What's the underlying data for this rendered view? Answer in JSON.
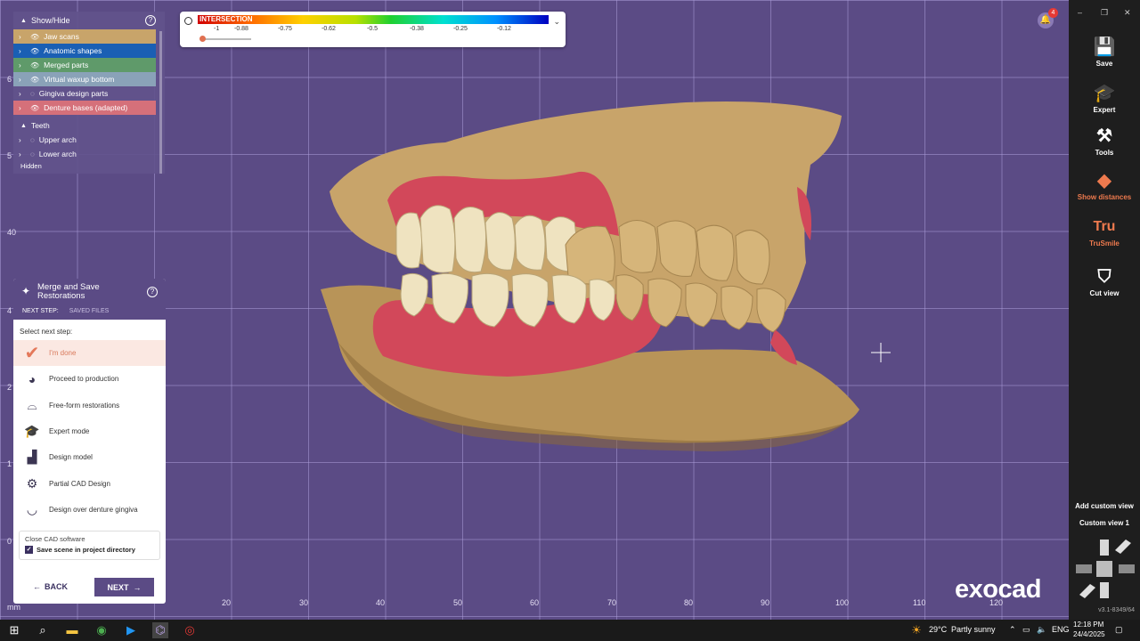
{
  "window_controls": {
    "minimize": "–",
    "restore": "❐",
    "close": "✕"
  },
  "scale": {
    "title": "INTERSECTION",
    "ticks": [
      "-1",
      "-0.88",
      "-0.75",
      "-0.62",
      "-0.5",
      "-0.38",
      "-0.25",
      "-0.12"
    ],
    "slider_fraction": 0.05,
    "icon": "gauge-icon",
    "expand_icon": "chevron-down-icon"
  },
  "showhide": {
    "title": "Show/Hide",
    "items": [
      {
        "label": "Jaw scans",
        "color": "#c8a46a"
      },
      {
        "label": "Anatomic shapes",
        "color": "#1a5fb4"
      },
      {
        "label": "Merged parts",
        "color": "#5f9a6a"
      },
      {
        "label": "Virtual waxup bottom",
        "color": "#8aa2b8"
      },
      {
        "label": "Gingiva design parts",
        "color": ""
      },
      {
        "label": "Denture bases (adapted)",
        "color": "#d5707a"
      }
    ],
    "teeth_label": "Teeth",
    "teeth_items": [
      "Upper arch",
      "Lower arch"
    ],
    "hidden_label": "Hidden"
  },
  "merge": {
    "title": "Merge and Save Restorations",
    "tab_next": "NEXT STEP:",
    "tab_saved": "SAVED FILES",
    "select_label": "Select next step:",
    "options": [
      {
        "label": "I'm done",
        "icon": "checkmark-icon",
        "active": true
      },
      {
        "label": "Proceed to production",
        "icon": "production-icon"
      },
      {
        "label": "Free-form restorations",
        "icon": "freeform-icon"
      },
      {
        "label": "Expert mode",
        "icon": "expert-cap-icon"
      },
      {
        "label": "Design model",
        "icon": "design-model-icon"
      },
      {
        "label": "Partial CAD Design",
        "icon": "partial-cad-icon"
      },
      {
        "label": "Design over denture gingiva",
        "icon": "gingiva-icon"
      }
    ],
    "close_cad": "Close CAD software",
    "save_scene": "Save scene in project directory",
    "back": "BACK",
    "next": "NEXT"
  },
  "toolbar": {
    "save": "Save",
    "expert": "Expert",
    "tools": "Tools",
    "show_distances": "Show distances",
    "trusmile": "TruSmile",
    "trusmile_glyph": "Tru",
    "cut_view": "Cut view",
    "add_custom_view": "Add custom view",
    "custom_view_1": "Custom view 1",
    "version": "v3.1-8349/64",
    "accent": "#ee7a4e"
  },
  "axis": {
    "bottom": [
      "20",
      "30",
      "40",
      "50",
      "60",
      "70",
      "80",
      "90",
      "100",
      "110",
      "120"
    ],
    "left": [
      "6",
      "40",
      "5",
      "4",
      "2",
      "1",
      "0"
    ],
    "unit": "mm"
  },
  "notifications": {
    "count": "4"
  },
  "logo": "exocad",
  "taskbar": {
    "weather_temp": "29°C",
    "weather_desc": "Partly sunny",
    "lang": "ENG",
    "time": "12:18 PM",
    "date": "24/4/2025"
  }
}
